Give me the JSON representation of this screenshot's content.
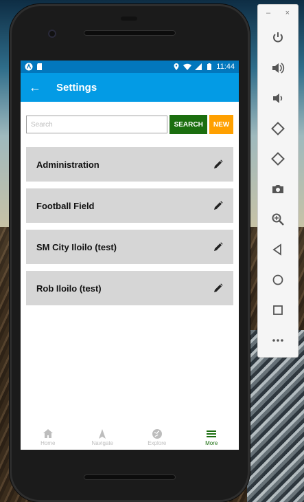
{
  "status_bar": {
    "time": "11:44"
  },
  "app_bar": {
    "title": "Settings"
  },
  "search": {
    "placeholder": "Search",
    "value": "",
    "search_label": "SEARCH",
    "new_label": "NEW"
  },
  "list": [
    {
      "label": "Administration"
    },
    {
      "label": "Football Field"
    },
    {
      "label": "SM City Iloilo (test)"
    },
    {
      "label": "Rob Iloilo (test)"
    }
  ],
  "bottom_nav": [
    {
      "label": "Home",
      "icon": "home-icon",
      "active": false
    },
    {
      "label": "Navigate",
      "icon": "navigate-icon",
      "active": false
    },
    {
      "label": "Explore",
      "icon": "explore-icon",
      "active": false
    },
    {
      "label": "More",
      "icon": "menu-icon",
      "active": true
    }
  ],
  "emulator": {
    "minimize": "–",
    "close": "×",
    "buttons": [
      "power-icon",
      "volume-up-icon",
      "volume-down-icon",
      "rotate-left-icon",
      "rotate-right-icon",
      "camera-icon",
      "zoom-icon",
      "back-icon",
      "home-icon",
      "overview-icon",
      "more-icon"
    ]
  },
  "colors": {
    "status": "#0277bd",
    "appbar": "#039be5",
    "search_btn": "#1b6e0f",
    "new_btn": "#ffa000",
    "item_bg": "#d6d6d6",
    "active_nav": "#1b6e0f"
  }
}
